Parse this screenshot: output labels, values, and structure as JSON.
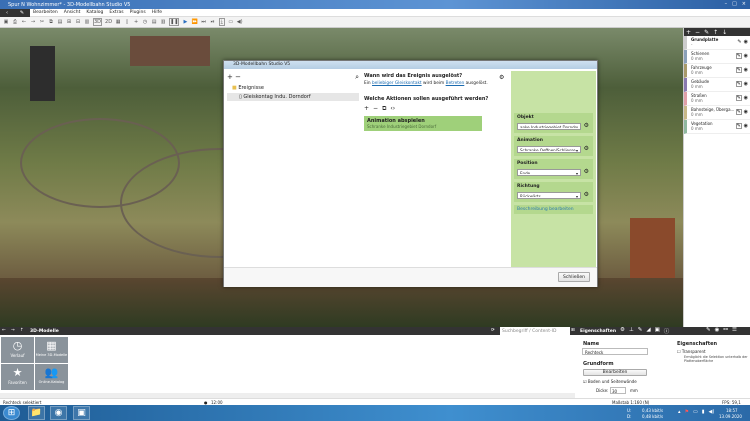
{
  "window": {
    "title": "Spur N Wohnzimmer* - 3D-Modellbahn Studio V5",
    "min": "–",
    "max": "□",
    "close": "×"
  },
  "menu": [
    "Bearbeiten",
    "Ansicht",
    "Katalog",
    "Extras",
    "Plugins",
    "Hilfe"
  ],
  "toolbar": {
    "view3d": "3D",
    "view2d": "2D"
  },
  "layers": {
    "header": "Grundplatte",
    "header_sub": "-",
    "items": [
      {
        "name": "Schienen",
        "value": "0 mm",
        "color": "#8aa0b8"
      },
      {
        "name": "Fahrzeuge",
        "value": "0 mm",
        "color": "#a89a6a"
      },
      {
        "name": "Gebäude",
        "value": "0 mm",
        "color": "#8a7ab0"
      },
      {
        "name": "Straßen",
        "value": "0 mm",
        "color": "#e0a0a8"
      },
      {
        "name": "Bahnsteige, Überga...",
        "value": "0 mm",
        "color": "#c8b888"
      },
      {
        "name": "Vegetation",
        "value": "0 mm",
        "color": "#90b8a0"
      }
    ]
  },
  "dialog": {
    "title": "3D-Modellbahn Studio V5",
    "tree": {
      "folder": "Ereignisse",
      "item": "Gleiskontag Indu. Dorndorf"
    },
    "question1": "Wann wird das Ereignis ausgelöst?",
    "sentence": {
      "pre": "Ein",
      "link1": "beliebiger Gleiskontakt",
      "mid": "wird beim",
      "link2": "Betreten",
      "post": "ausgelöst."
    },
    "question2": "Welche Aktionen sollen ausgeführt werden?",
    "action": {
      "title": "Animation abspielen",
      "sub": "Schranke Industriegebiet Dorndorf"
    },
    "props": [
      {
        "label": "Objekt",
        "value": "anke Industriegebiet Dorndorf fe"
      },
      {
        "label": "Animation",
        "value": "Schranke Oeffnen/Schliesser"
      },
      {
        "label": "Position",
        "value": "Ende"
      },
      {
        "label": "Richtung",
        "value": "Rückwärts"
      }
    ],
    "edit_desc": "Beschreibung bearbeiten",
    "close": "Schließen"
  },
  "bottom": {
    "title": "3D-Modelle",
    "tiles": [
      {
        "label": "Verlauf",
        "icon": "clock"
      },
      {
        "label": "Meine 3D-Modelle",
        "icon": "grid"
      },
      {
        "label": "Favoriten",
        "icon": "star"
      },
      {
        "label": "Online-Katalog",
        "icon": "people"
      }
    ],
    "search_placeholder": "Suchbegriff / Content-ID",
    "props_title": "Eigenschaften",
    "name_label": "Name",
    "name_value": "Rechteck",
    "grundform": "Grundform",
    "edit_btn": "Bearbeiten",
    "boden_label": "Boden und Seitenwände",
    "dicke_label": "Dicke:",
    "dicke_value": "30",
    "dicke_unit": "mm",
    "eig_title": "Eigenschaften",
    "transparent": "Transparent",
    "transparent_desc": "Ermöglicht die Selektion unterhalb der Plattenoberfläche"
  },
  "status": {
    "left": "Rechteck selektiert",
    "time": "12:00",
    "scale": "Maßstab 1:160 (N)",
    "fps": "FPS: 59,1"
  },
  "taskbar": {
    "net_u": "U:",
    "net_u_val": "0,43 kbit/s",
    "net_d": "D:",
    "net_d_val": "0,48 kbit/s",
    "clock": "18:57",
    "date": "13.09.2020"
  }
}
